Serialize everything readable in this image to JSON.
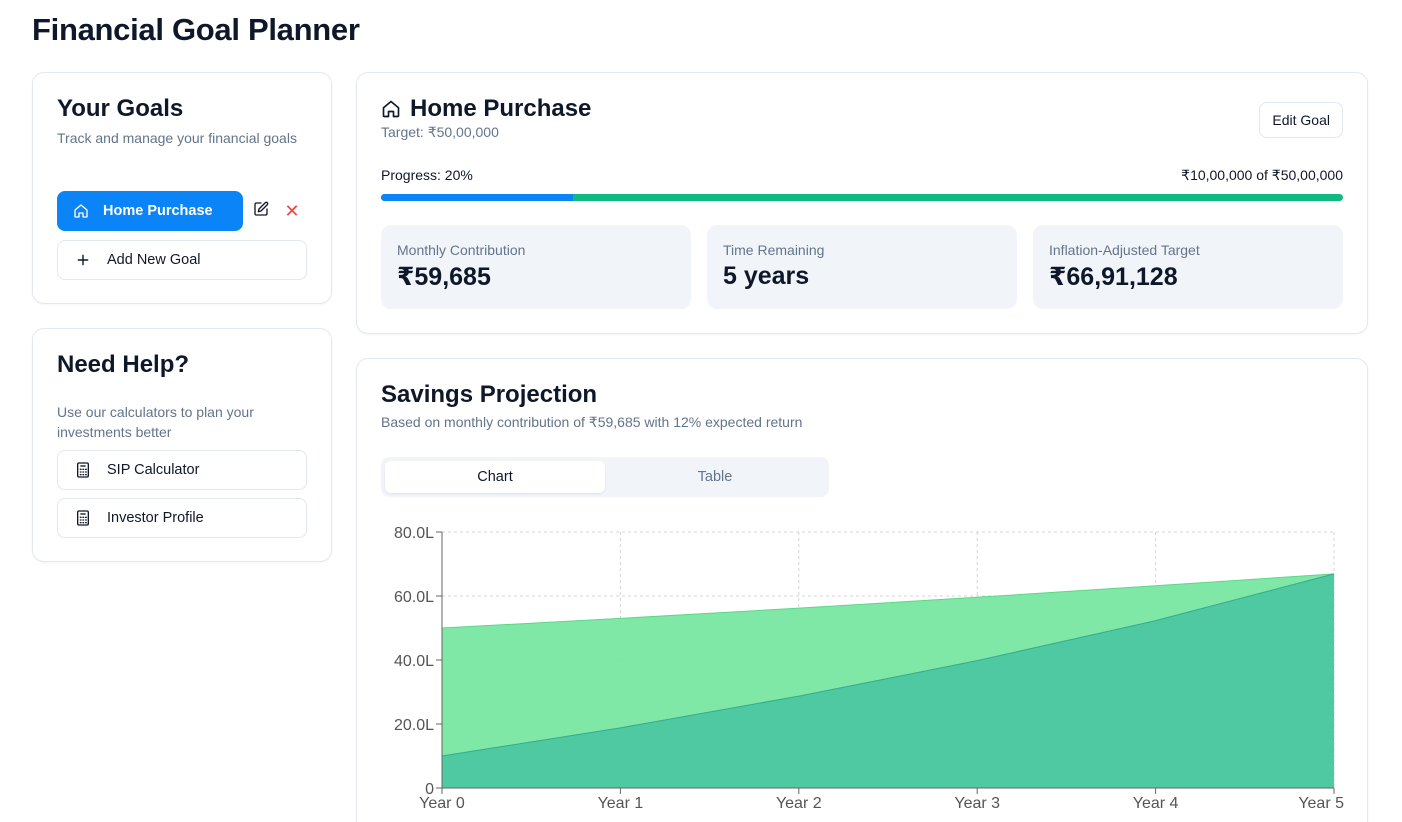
{
  "app": {
    "title": "Financial Goal Planner"
  },
  "goals_panel": {
    "title": "Your Goals",
    "subtitle": "Track and manage your financial goals",
    "goals": [
      {
        "label": "Home Purchase",
        "icon": "home-icon"
      }
    ],
    "edit_icon": "edit-icon",
    "delete_icon": "close-icon",
    "delete_symbol": "✕",
    "add_label": "Add New Goal",
    "add_symbol": "+"
  },
  "help_panel": {
    "title": "Need Help?",
    "subtitle": "Use our calculators to plan your investments better",
    "links": [
      {
        "label": "SIP Calculator",
        "icon": "calculator-icon"
      },
      {
        "label": "Investor Profile",
        "icon": "calculator-icon"
      }
    ]
  },
  "goal": {
    "icon": "home-icon",
    "title": "Home Purchase",
    "target_text": "Target: ₹50,00,000",
    "edit_label": "Edit Goal",
    "progress_label": "Progress: 20%",
    "progress_fraction": 0.2,
    "progress_amount": "₹10,00,000 of ₹50,00,000",
    "stats": [
      {
        "label": "Monthly Contribution",
        "value": "₹59,685"
      },
      {
        "label": "Time Remaining",
        "value": "5 years"
      },
      {
        "label": "Inflation-Adjusted Target",
        "value": "₹66,91,128"
      }
    ]
  },
  "projection": {
    "title": "Savings Projection",
    "subtitle": "Based on monthly contribution of ₹59,685 with 12% expected return",
    "tabs": [
      "Chart",
      "Table"
    ],
    "active_tab": 0
  },
  "colors": {
    "primary": "#0b84f8",
    "progress_rest": "#10b981",
    "target_area": "#79e7a1",
    "savings_area": "#4bc7a0",
    "delete": "#ef4444"
  },
  "chart_data": {
    "type": "area",
    "x": [
      "Year 0",
      "Year 1",
      "Year 2",
      "Year 3",
      "Year 4",
      "Year 5"
    ],
    "yticks": [
      "0",
      "20.0L",
      "40.0L",
      "60.0L",
      "80.0L"
    ],
    "ylim": [
      0,
      8000000
    ],
    "series": [
      {
        "values": [
          5000000,
          5300000,
          5620000,
          5960000,
          6320000,
          6691128
        ],
        "color": "#79e7a1"
      },
      {
        "values": [
          1000000,
          1880000,
          2870000,
          3980000,
          5230000,
          6691128
        ],
        "color": "#4bc7a0"
      }
    ],
    "grid": true
  }
}
